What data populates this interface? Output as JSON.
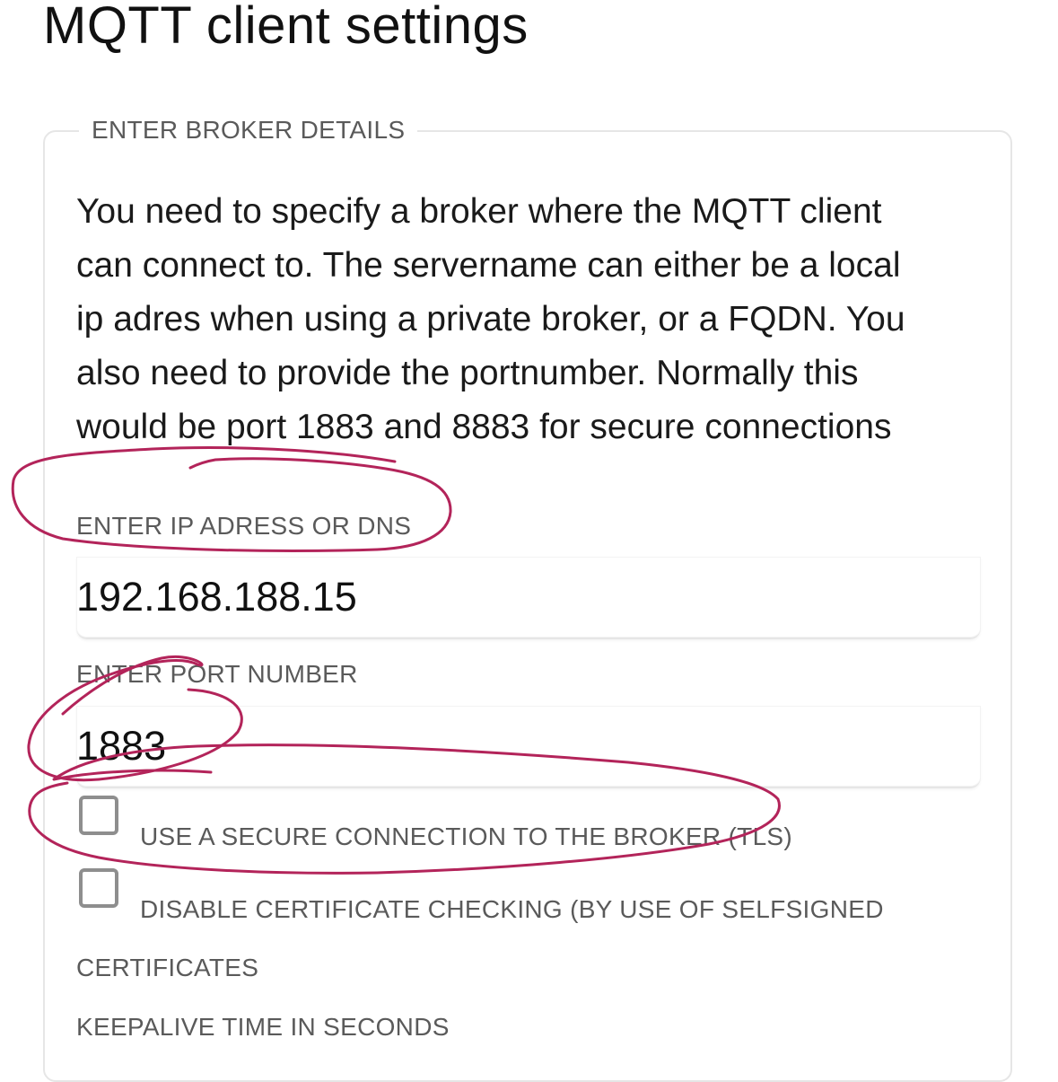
{
  "page": {
    "title": "MQTT client settings"
  },
  "broker_section": {
    "legend": "ENTER BROKER DETAILS",
    "intro_lines": [
      "You need to specify a broker where the MQTT client",
      "can connect to. The servername can either be a local",
      "ip adres when using a private broker, or a FQDN. You",
      "also need to provide the portnumber. Normally this",
      "would be port 1883 and 8883 for secure connections"
    ],
    "ip_field": {
      "label": "ENTER IP ADRESS OR DNS",
      "value": "192.168.188.15"
    },
    "port_field": {
      "label": "ENTER PORT NUMBER",
      "value": "1883"
    },
    "secure_checkbox": {
      "label": "USE A SECURE CONNECTION TO THE BROKER (TLS)",
      "checked": false
    },
    "cert_checkbox": {
      "label": "DISABLE CERTIFICATE CHECKING (BY USE OF SELFSIGNED",
      "label_continued": "CERTIFICATES",
      "checked": false
    },
    "keepalive_field": {
      "label": "KEEPALIVE TIME IN SECONDS"
    }
  },
  "colors": {
    "annotation_ink": "#b3245a",
    "label_gray": "#5a5a5a",
    "border_gray": "#e6e6e6",
    "checkbox_gray": "#8e8e8e"
  }
}
